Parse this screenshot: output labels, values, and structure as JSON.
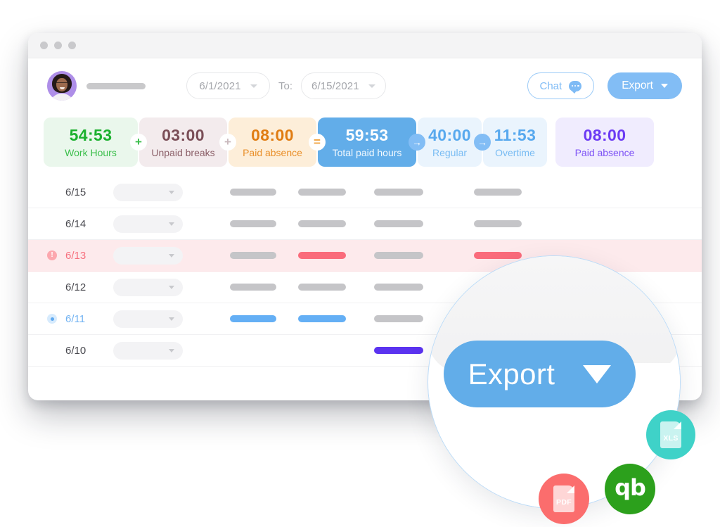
{
  "window": {
    "traffic_dots": 3
  },
  "toolbar": {
    "avatar_label": "user-avatar",
    "date_from": "6/1/2021",
    "to_label": "To:",
    "date_to": "6/15/2021",
    "chat_label": "Chat",
    "export_label": "Export"
  },
  "stats": {
    "cards": [
      {
        "value": "54:53",
        "label": "Work Hours",
        "bg": "#eaf7ec",
        "value_color": "#1cb12f",
        "label_color": "#3cbf4c"
      },
      {
        "value": "03:00",
        "label": "Unpaid breaks",
        "bg": "#f3ebed",
        "value_color": "#7b4f58",
        "label_color": "#8b5f68"
      },
      {
        "value": "08:00",
        "label": "Paid absence",
        "bg": "#fdeed9",
        "value_color": "#e07c12",
        "label_color": "#e98f29"
      },
      {
        "value": "59:53",
        "label": "Total paid hours",
        "bg": "#62ade9",
        "value_color": "#ffffff",
        "label_color": "#f2f9fe"
      },
      {
        "value": "40:00",
        "label": "Regular",
        "bg": "#eaf4fd",
        "value_color": "#58a9ee",
        "label_color": "#79bcf3"
      },
      {
        "value": "11:53",
        "label": "Overtime",
        "bg": "#eaf4fd",
        "value_color": "#58a9ee",
        "label_color": "#79bcf3"
      },
      {
        "value": "08:00",
        "label": "Paid absence",
        "bg": "#f0ecfe",
        "value_color": "#6c3bf4",
        "label_color": "#7d52f5"
      }
    ],
    "operators": [
      {
        "after": 0,
        "glyph": "+",
        "color": "#3cbf4c"
      },
      {
        "after": 1,
        "glyph": "+",
        "color": "#c9b9bd"
      },
      {
        "after": 2,
        "glyph": "=",
        "color": "#f0a340"
      },
      {
        "after": 3,
        "glyph": "→",
        "color": "#ffffff"
      },
      {
        "after": 4,
        "glyph": "→",
        "color": "#ffffff"
      }
    ]
  },
  "table": {
    "rows": [
      {
        "date": "6/15",
        "status": "none",
        "cells": [
          "bar",
          "bar",
          "bar",
          "bar",
          "none"
        ]
      },
      {
        "date": "6/14",
        "status": "none",
        "cells": [
          "bar",
          "bar",
          "bar",
          "bar",
          "dash"
        ]
      },
      {
        "date": "6/13",
        "status": "alert",
        "cells": [
          "bar",
          "red",
          "bar",
          "red",
          "none"
        ]
      },
      {
        "date": "6/12",
        "status": "none",
        "cells": [
          "bar",
          "bar",
          "bar",
          "none",
          "dash"
        ]
      },
      {
        "date": "6/11",
        "status": "active",
        "cells": [
          "blue",
          "blue",
          "bar",
          "none",
          "none"
        ]
      },
      {
        "date": "6/10",
        "status": "none",
        "cells": [
          "dash",
          "dash",
          "violet",
          "none",
          "none"
        ]
      }
    ],
    "alert_glyph": "!"
  },
  "magnifier": {
    "export_label": "Export"
  },
  "badges": [
    {
      "name": "xls",
      "text": "XLS"
    },
    {
      "name": "quickbooks",
      "text": "qb"
    },
    {
      "name": "pdf",
      "text": "PDF"
    }
  ]
}
